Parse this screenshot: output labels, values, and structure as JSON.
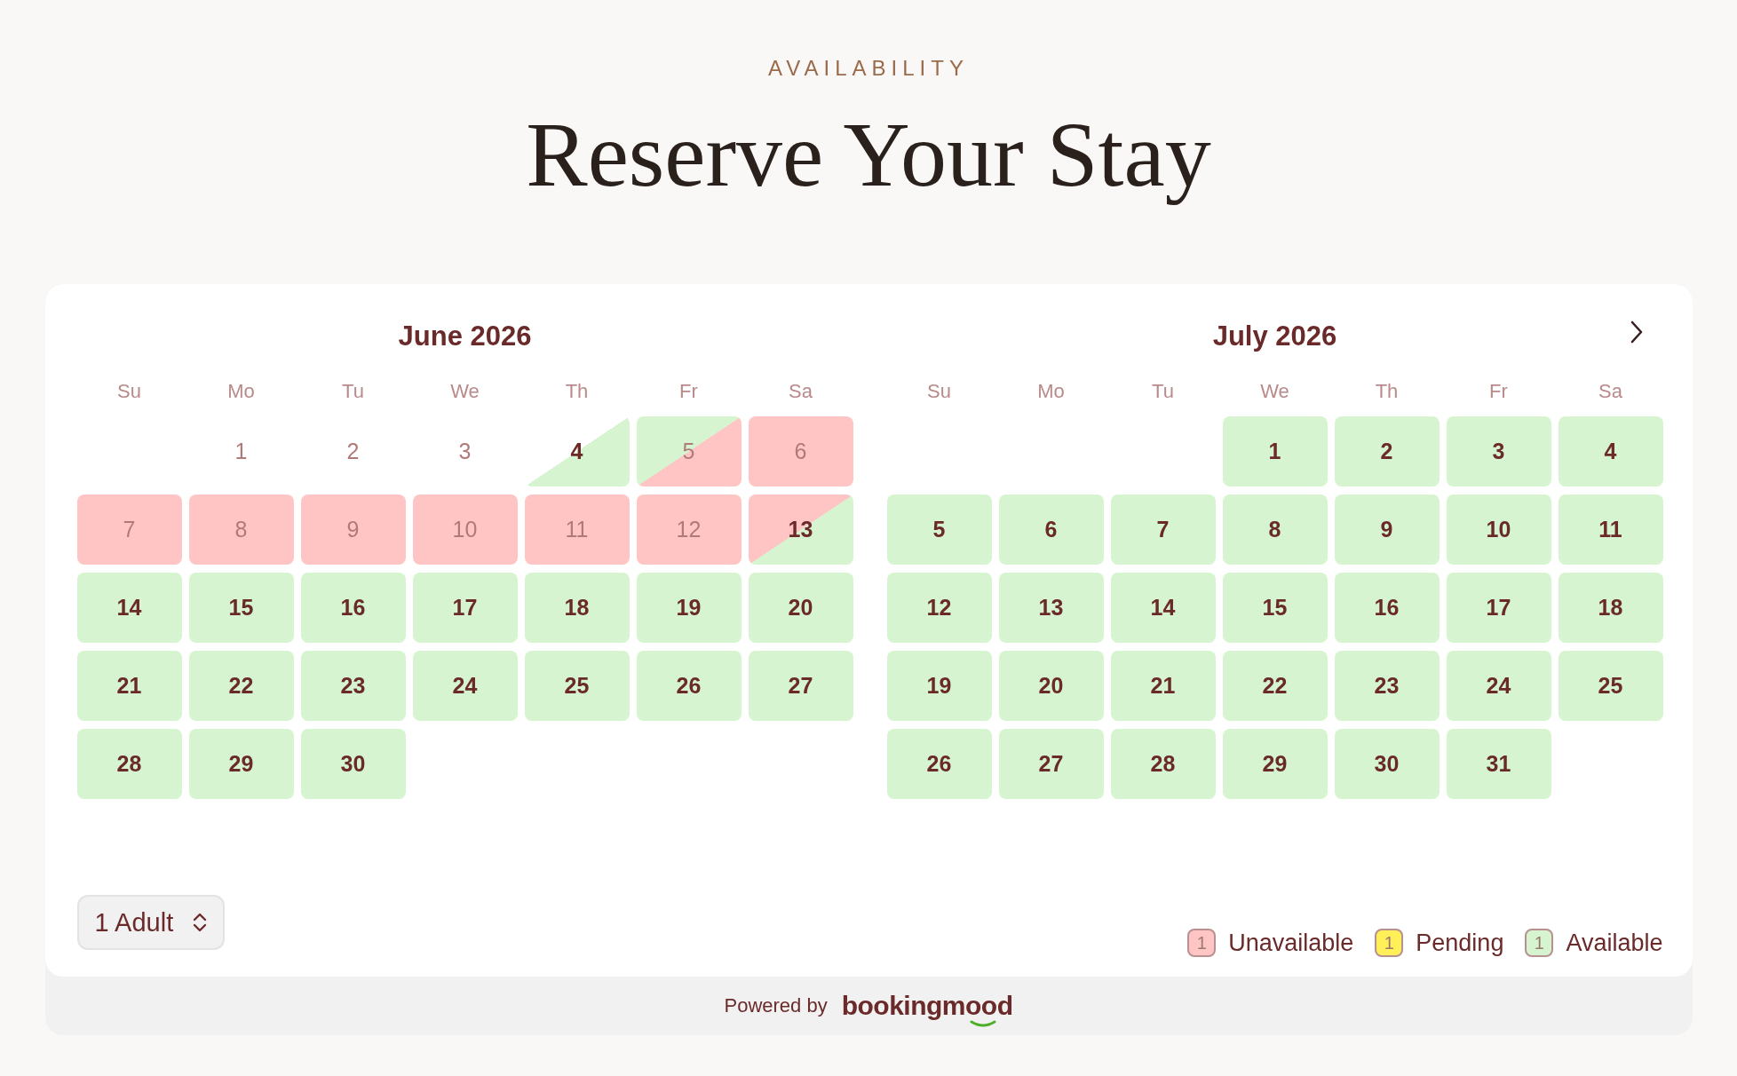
{
  "eyebrow": "AVAILABILITY",
  "title": "Reserve Your Stay",
  "months": [
    {
      "name": "June 2026",
      "weekdays": [
        "Su",
        "Mo",
        "Tu",
        "We",
        "Th",
        "Fr",
        "Sa"
      ],
      "days": [
        {
          "kind": "blank"
        },
        {
          "day": "1",
          "kind": "past"
        },
        {
          "day": "2",
          "kind": "past"
        },
        {
          "day": "3",
          "kind": "past"
        },
        {
          "day": "4",
          "kind": "opening"
        },
        {
          "day": "5",
          "kind": "checkout"
        },
        {
          "day": "6",
          "kind": "unavailable"
        },
        {
          "day": "7",
          "kind": "unavailable"
        },
        {
          "day": "8",
          "kind": "unavailable"
        },
        {
          "day": "9",
          "kind": "unavailable"
        },
        {
          "day": "10",
          "kind": "unavailable"
        },
        {
          "day": "11",
          "kind": "unavailable"
        },
        {
          "day": "12",
          "kind": "unavailable"
        },
        {
          "day": "13",
          "kind": "checkin"
        },
        {
          "day": "14",
          "kind": "available"
        },
        {
          "day": "15",
          "kind": "available"
        },
        {
          "day": "16",
          "kind": "available"
        },
        {
          "day": "17",
          "kind": "available"
        },
        {
          "day": "18",
          "kind": "available"
        },
        {
          "day": "19",
          "kind": "available"
        },
        {
          "day": "20",
          "kind": "available"
        },
        {
          "day": "21",
          "kind": "available"
        },
        {
          "day": "22",
          "kind": "available"
        },
        {
          "day": "23",
          "kind": "available"
        },
        {
          "day": "24",
          "kind": "available"
        },
        {
          "day": "25",
          "kind": "available"
        },
        {
          "day": "26",
          "kind": "available"
        },
        {
          "day": "27",
          "kind": "available"
        },
        {
          "day": "28",
          "kind": "available"
        },
        {
          "day": "29",
          "kind": "available"
        },
        {
          "day": "30",
          "kind": "available"
        }
      ]
    },
    {
      "name": "July 2026",
      "weekdays": [
        "Su",
        "Mo",
        "Tu",
        "We",
        "Th",
        "Fr",
        "Sa"
      ],
      "next_arrow": true,
      "days": [
        {
          "kind": "blank"
        },
        {
          "kind": "blank"
        },
        {
          "kind": "blank"
        },
        {
          "day": "1",
          "kind": "available"
        },
        {
          "day": "2",
          "kind": "available"
        },
        {
          "day": "3",
          "kind": "available"
        },
        {
          "day": "4",
          "kind": "available"
        },
        {
          "day": "5",
          "kind": "available"
        },
        {
          "day": "6",
          "kind": "available"
        },
        {
          "day": "7",
          "kind": "available"
        },
        {
          "day": "8",
          "kind": "available"
        },
        {
          "day": "9",
          "kind": "available"
        },
        {
          "day": "10",
          "kind": "available"
        },
        {
          "day": "11",
          "kind": "available"
        },
        {
          "day": "12",
          "kind": "available"
        },
        {
          "day": "13",
          "kind": "available"
        },
        {
          "day": "14",
          "kind": "available"
        },
        {
          "day": "15",
          "kind": "available"
        },
        {
          "day": "16",
          "kind": "available"
        },
        {
          "day": "17",
          "kind": "available"
        },
        {
          "day": "18",
          "kind": "available"
        },
        {
          "day": "19",
          "kind": "available"
        },
        {
          "day": "20",
          "kind": "available"
        },
        {
          "day": "21",
          "kind": "available"
        },
        {
          "day": "22",
          "kind": "available"
        },
        {
          "day": "23",
          "kind": "available"
        },
        {
          "day": "24",
          "kind": "available"
        },
        {
          "day": "25",
          "kind": "available"
        },
        {
          "day": "26",
          "kind": "available"
        },
        {
          "day": "27",
          "kind": "available"
        },
        {
          "day": "28",
          "kind": "available"
        },
        {
          "day": "29",
          "kind": "available"
        },
        {
          "day": "30",
          "kind": "available"
        },
        {
          "day": "31",
          "kind": "available"
        }
      ]
    }
  ],
  "guests": {
    "value": "1 Adult"
  },
  "legend": [
    {
      "sample": "1",
      "label": "Unavailable",
      "color": "#ffc5c5"
    },
    {
      "sample": "1",
      "label": "Pending",
      "color": "#fff05a"
    },
    {
      "sample": "1",
      "label": "Available",
      "color": "#d5f4cf"
    }
  ],
  "footer": {
    "text": "Powered by",
    "brand": "bookingmood"
  }
}
